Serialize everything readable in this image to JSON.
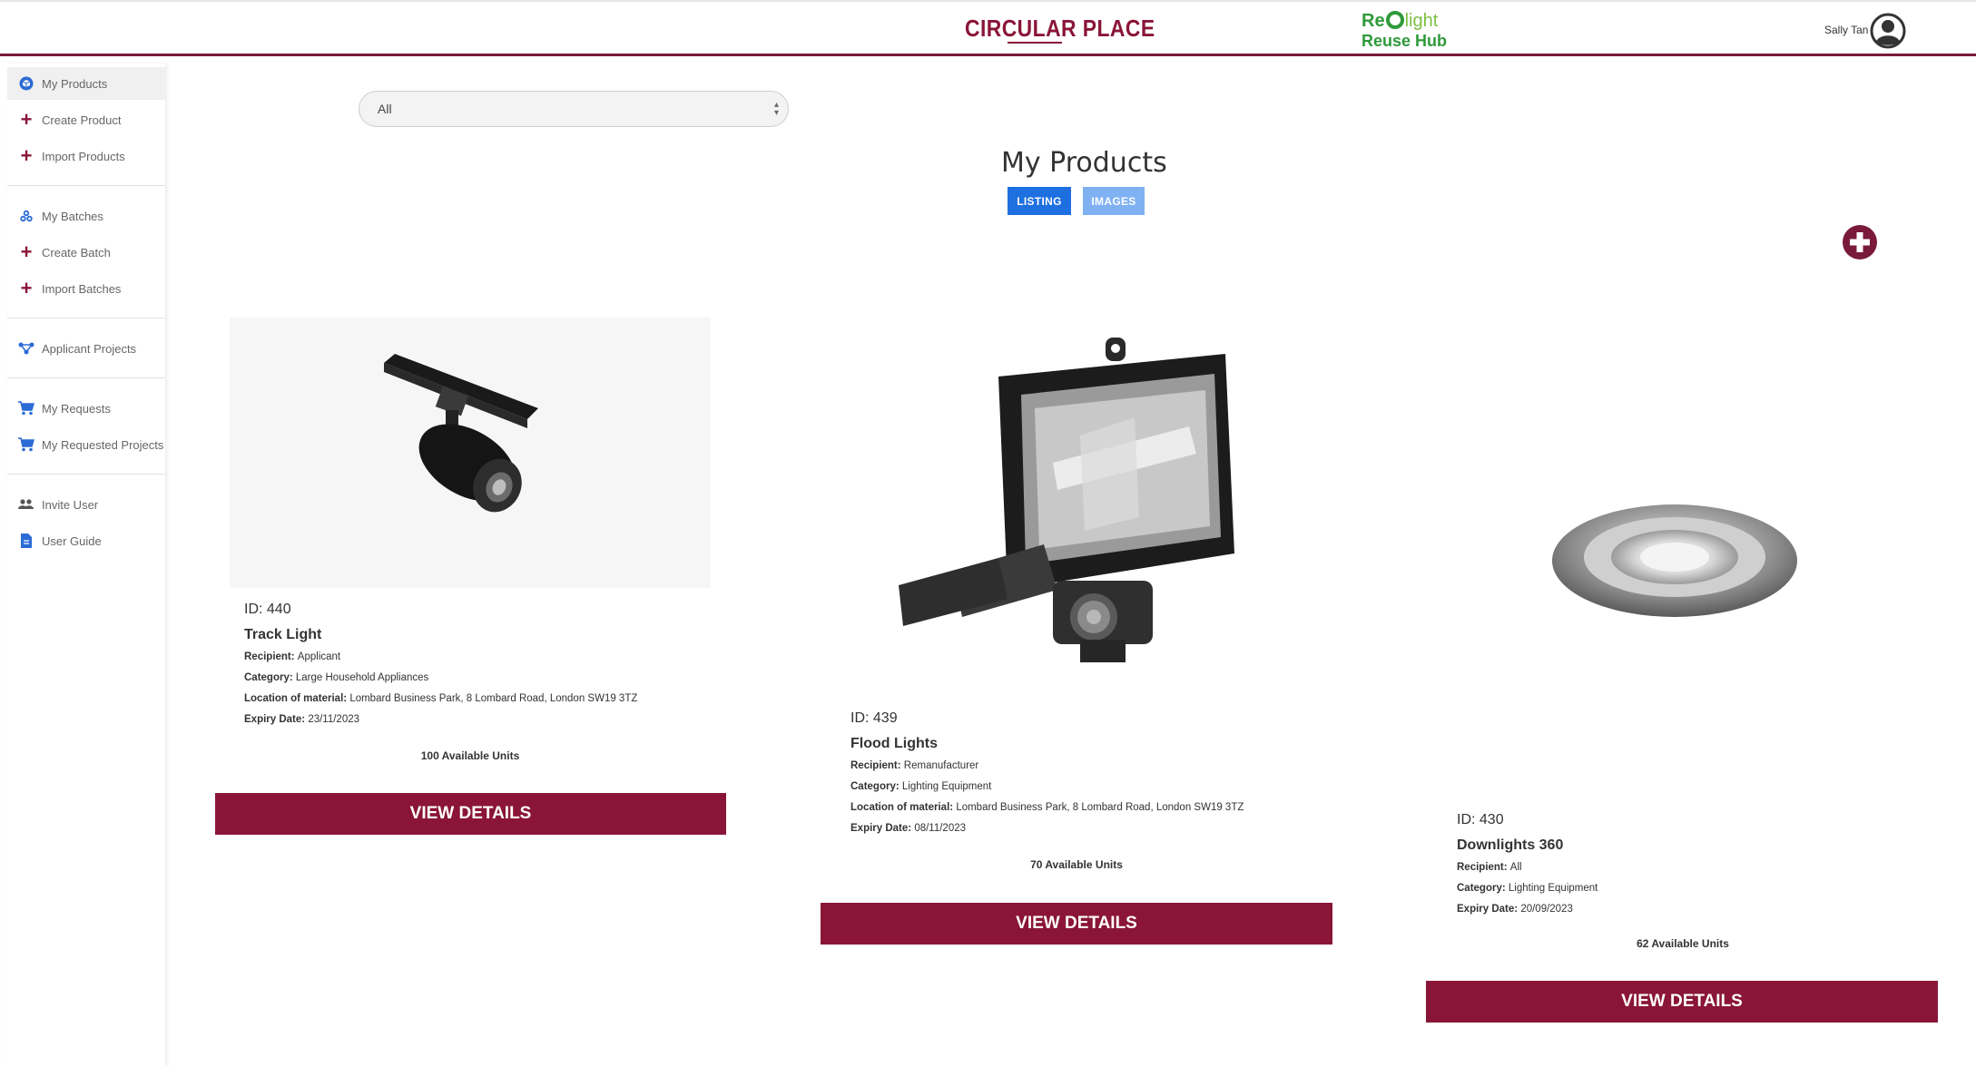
{
  "header": {
    "brand": "CIRCULAR PLACE",
    "logo_line1_a": "Re",
    "logo_line1_b": "light",
    "logo_line2": "Reuse Hub",
    "user_name": "Sally Tan"
  },
  "sidebar": {
    "items": [
      {
        "label": "My Products",
        "icon": "cube-icon"
      },
      {
        "label": "Create Product",
        "icon": "plus-icon"
      },
      {
        "label": "Import Products",
        "icon": "plus-icon"
      },
      {
        "label": "My Batches",
        "icon": "batches-icon"
      },
      {
        "label": "Create Batch",
        "icon": "plus-icon"
      },
      {
        "label": "Import Batches",
        "icon": "plus-icon"
      },
      {
        "label": "Applicant Projects",
        "icon": "network-icon"
      },
      {
        "label": "My Requests",
        "icon": "cart-icon"
      },
      {
        "label": "My Requested Projects",
        "icon": "cart-icon"
      },
      {
        "label": "Invite User",
        "icon": "users-icon"
      },
      {
        "label": "User Guide",
        "icon": "document-icon"
      }
    ]
  },
  "filter": {
    "selected": "All"
  },
  "main": {
    "title": "My Products",
    "tabs": [
      {
        "label": "LISTING"
      },
      {
        "label": "IMAGES"
      }
    ]
  },
  "products": [
    {
      "id": "ID: 440",
      "name": "Track Light",
      "recipient_label": "Recipient:",
      "recipient": "Applicant",
      "category_label": "Category:",
      "category": "Large Household Appliances",
      "location_label": "Location of material:",
      "location": "Lombard Business Park, 8 Lombard Road, London SW19 3TZ",
      "expiry_label": "Expiry Date:",
      "expiry": "23/11/2023",
      "units": "100 Available Units",
      "button": "VIEW DETAILS"
    },
    {
      "id": "ID: 439",
      "name": "Flood Lights",
      "recipient_label": "Recipient:",
      "recipient": "Remanufacturer",
      "category_label": "Category:",
      "category": "Lighting Equipment",
      "location_label": "Location of material:",
      "location": "Lombard Business Park, 8 Lombard Road, London SW19 3TZ",
      "expiry_label": "Expiry Date:",
      "expiry": "08/11/2023",
      "units": "70 Available Units",
      "button": "VIEW DETAILS"
    },
    {
      "id": "ID: 430",
      "name": "Downlights 360",
      "recipient_label": "Recipient:",
      "recipient": "All",
      "category_label": "Category:",
      "category": "Lighting Equipment",
      "expiry_label": "Expiry Date:",
      "expiry": "20/09/2023",
      "units": "62 Available Units",
      "button": "VIEW DETAILS"
    }
  ],
  "colors": {
    "brand": "#8a1538",
    "listing_tab": "#1e6fe0",
    "images_tab": "#7fb1f3",
    "logo_green": "#2f9a3a"
  }
}
